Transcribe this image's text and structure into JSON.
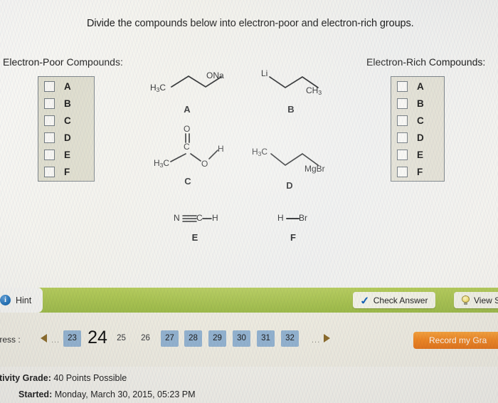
{
  "prompt": "Divide the compounds below into electron-poor and electron-rich groups.",
  "groups": {
    "poor": {
      "heading": "Electron-Poor Compounds:",
      "options": [
        {
          "label": "A",
          "checked": false
        },
        {
          "label": "B",
          "checked": false
        },
        {
          "label": "C",
          "checked": false
        },
        {
          "label": "D",
          "checked": false
        },
        {
          "label": "E",
          "checked": false
        },
        {
          "label": "F",
          "checked": false
        }
      ]
    },
    "rich": {
      "heading": "Electron-Rich Compounds:",
      "options": [
        {
          "label": "A",
          "checked": false
        },
        {
          "label": "B",
          "checked": false
        },
        {
          "label": "C",
          "checked": false
        },
        {
          "label": "D",
          "checked": false
        },
        {
          "label": "E",
          "checked": false
        },
        {
          "label": "F",
          "checked": false
        }
      ]
    }
  },
  "compounds": [
    {
      "id": "A",
      "label": "A",
      "name": "sodium propoxide",
      "left_group": "H3C",
      "right_group": "ONa"
    },
    {
      "id": "B",
      "label": "B",
      "name": "propyllithium",
      "left_group": "Li",
      "right_group": "CH3"
    },
    {
      "id": "C",
      "label": "C",
      "name": "acetic acid",
      "methyl": "H3C",
      "carbonyl_carbon": "C",
      "carbonyl_oxygen": "O",
      "hydroxyl_oxygen": "O",
      "hydroxyl_hydrogen": "H"
    },
    {
      "id": "D",
      "label": "D",
      "name": "propylmagnesium bromide",
      "left_group": "H3C",
      "right_group": "MgBr"
    },
    {
      "id": "E",
      "label": "E",
      "name": "hydrogen cyanide",
      "atom_n": "N",
      "atom_c": "C",
      "atom_h": "H"
    },
    {
      "id": "F",
      "label": "F",
      "name": "hydrogen bromide",
      "atom_h": "H",
      "atom_br": "Br"
    }
  ],
  "action_bar": {
    "hint_label": "Hint",
    "info_glyph": "i",
    "check_answer_label": "Check Answer",
    "view_solution_label": "View So"
  },
  "progress": {
    "label": "ogress :",
    "ellipsis_left": "...",
    "ellipsis_right": "...",
    "pages": [
      {
        "number": "23",
        "style": "filled"
      },
      {
        "number": "24",
        "style": "current"
      },
      {
        "number": "25",
        "style": "plain"
      },
      {
        "number": "26",
        "style": "plain"
      },
      {
        "number": "27",
        "style": "filled"
      },
      {
        "number": "28",
        "style": "filled"
      },
      {
        "number": "29",
        "style": "filled"
      },
      {
        "number": "30",
        "style": "filled"
      },
      {
        "number": "31",
        "style": "filled"
      },
      {
        "number": "32",
        "style": "filled"
      }
    ],
    "record_grade_label": "Record my Gra"
  },
  "footer": {
    "grade_title": "ctivity Grade:",
    "grade_value": "40 Points Possible",
    "started_title": "Started:",
    "started_value": "Monday, March 30, 2015, 05:23 PM"
  }
}
